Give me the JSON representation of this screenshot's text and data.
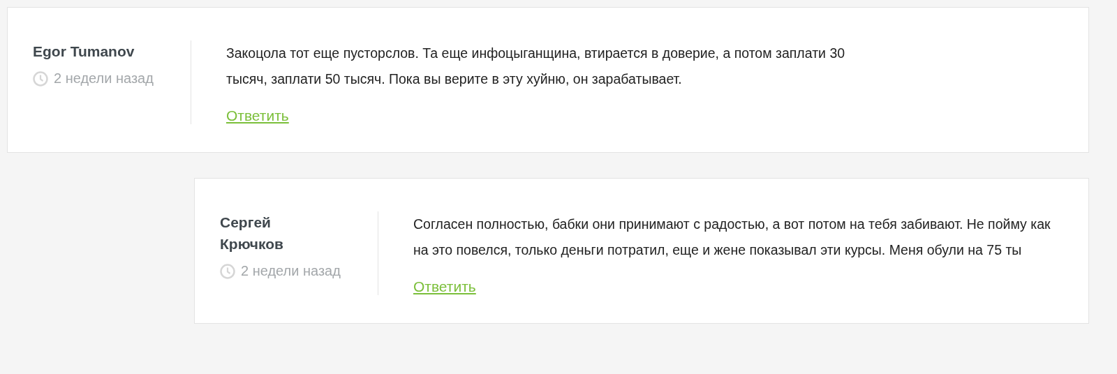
{
  "comments": [
    {
      "author": "Egor Tumanov",
      "time": "2 недели назад",
      "text": "Закоцола тот еще пусторслов. Та еще инфоцыганщина, втирается в доверие, а потом заплати 30 тысяч, заплати 50 тысяч. Пока вы верите в эту хуйню, он зарабатывает.",
      "reply": "Ответить",
      "children": [
        {
          "author": "Сергей Крючков",
          "time": "2 недели назад",
          "text": "Согласен полностью, бабки они принимают с радостью, а вот потом на тебя забивают. Не пойму как на это повелся, только деньги потратил, еще и жене показывал эти курсы. Меня обули на 75 ты",
          "reply": "Ответить"
        }
      ]
    }
  ]
}
